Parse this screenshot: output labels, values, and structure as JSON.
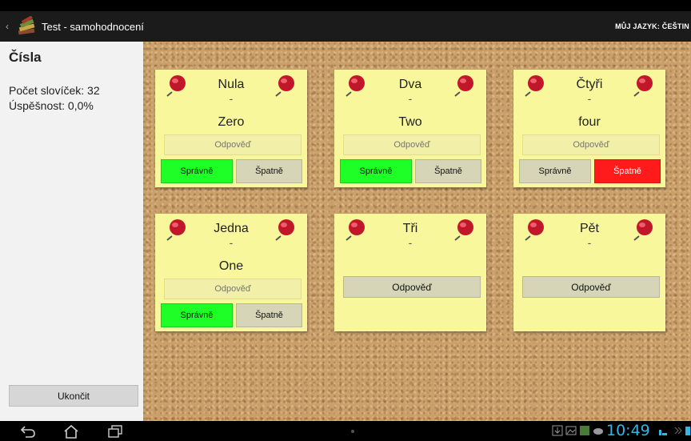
{
  "app": {
    "title": "Test - samohodnocení",
    "language_label": "MŮJ JAZYK: ČEŠTIN"
  },
  "sidebar": {
    "heading": "Čísla",
    "word_count": "Počet slovíček: 32",
    "success_rate": "Úspěšnost: 0,0%",
    "quit_label": "Ukončit"
  },
  "cards": [
    {
      "word": "Nula",
      "dash": "-",
      "translation": "Zero",
      "input_placeholder": "Odpověď",
      "correct_label": "Správně",
      "wrong_label": "Špatně",
      "state": "correct"
    },
    {
      "word": "Dva",
      "dash": "-",
      "translation": "Two",
      "input_placeholder": "Odpověď",
      "correct_label": "Správně",
      "wrong_label": "Špatně",
      "state": "correct"
    },
    {
      "word": "Čtyři",
      "dash": "-",
      "translation": "four",
      "input_placeholder": "Odpověď",
      "correct_label": "Správně",
      "wrong_label": "Špatně",
      "state": "wrong"
    },
    {
      "word": "Jedna",
      "dash": "-",
      "translation": "One",
      "input_placeholder": "Odpověď",
      "correct_label": "Správně",
      "wrong_label": "Špatně",
      "state": "correct"
    },
    {
      "word": "Tři",
      "dash": "-",
      "answer_label": "Odpověď",
      "state": "unanswered"
    },
    {
      "word": "Pět",
      "dash": "-",
      "answer_label": "Odpověď",
      "state": "unanswered"
    }
  ],
  "status_bar": {
    "time": "10:49"
  },
  "colors": {
    "correct": "#1dff26",
    "wrong": "#ff1b1b",
    "card": "#f9f79b",
    "clock": "#33b5e5"
  },
  "icons": [
    "back-icon",
    "home-icon",
    "recent-apps-icon",
    "app-books-icon",
    "pushpin-icon",
    "notification-icon",
    "battery-icon"
  ]
}
